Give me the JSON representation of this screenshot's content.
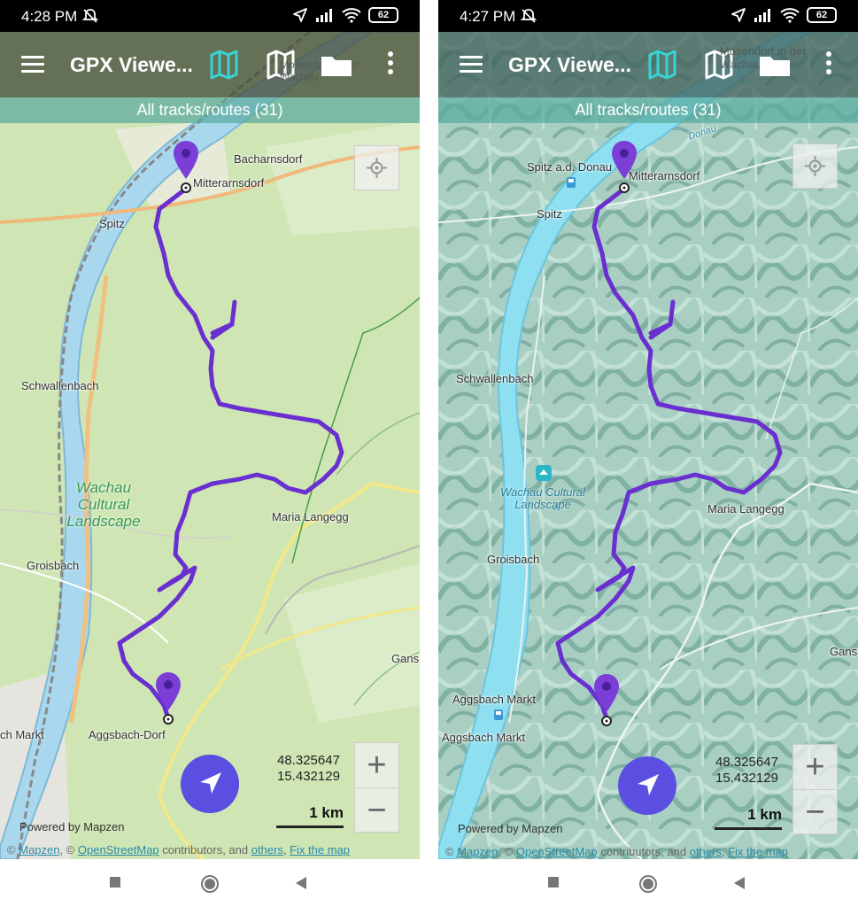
{
  "screens": [
    {
      "status": {
        "time": "4:28 PM",
        "battery": "62"
      },
      "app_title": "GPX Viewe...",
      "subtitle": "All tracks/routes (31)",
      "places": {
        "bacharnsdorf": "Bacharnsdorf",
        "mitterarnsdorf": "Mitterarnsdorf",
        "spitz": "Spitz",
        "schwallenbach": "Schwallenbach",
        "maria_langegg": "Maria Langegg",
        "groisbach": "Groisbach",
        "gans": "Gans",
        "aggsbach_dorf": "Aggsbach-Dorf",
        "aggsbach_markt": "ch Markt",
        "overlay_town": "Mosendorf in der Wachau"
      },
      "park_label": "Wachau Cultural Landscape",
      "coords": {
        "lat": "48.325647",
        "lon": "15.432129"
      },
      "scale": "1 km",
      "powered": "Powered by Mapzen",
      "attribution": {
        "mapzen": "Mapzen",
        "sep1": ", © ",
        "osm": "OpenStreetMap",
        "middle": " contributors, and ",
        "others": "others",
        "sep2": ", ",
        "fix": "Fix the map",
        "prefix": "© "
      }
    },
    {
      "status": {
        "time": "4:27 PM",
        "battery": "62"
      },
      "app_title": "GPX Viewe...",
      "subtitle": "All tracks/routes (31)",
      "places": {
        "spitz_donau": "Spitz a.d. Donau",
        "mitterarnsdorf": "Mitterarnsdorf",
        "spitz": "Spitz",
        "donau": "Donau",
        "schwallenbach": "Schwallenbach",
        "maria_langegg": "Maria Langegg",
        "groisbach": "Groisbach",
        "gans": "Gans",
        "aggsbach_markt": "Aggsbach Markt",
        "aggsbach_markt2": "Aggsbach Markt",
        "overlay_town": "Mosendorf in der Wachau"
      },
      "park_label": "Wachau Cultural Landscape",
      "coords": {
        "lat": "48.325647",
        "lon": "15.432129"
      },
      "scale": "1 km",
      "powered": "Powered by Mapzen",
      "attribution": {
        "mapzen": "Mapzen",
        "sep1": ", © ",
        "osm": "OpenStreetMap",
        "middle": " contributors, and ",
        "others": "others",
        "sep2": ", ",
        "fix": "Fix the map",
        "prefix": "© "
      }
    }
  ],
  "colors": {
    "track": "#6a2fd0",
    "accent_icon": "#36d4d4",
    "nav_button": "#5a4fe0",
    "river": "#8ed4f0",
    "terrain_green": "#c8e4b0"
  }
}
